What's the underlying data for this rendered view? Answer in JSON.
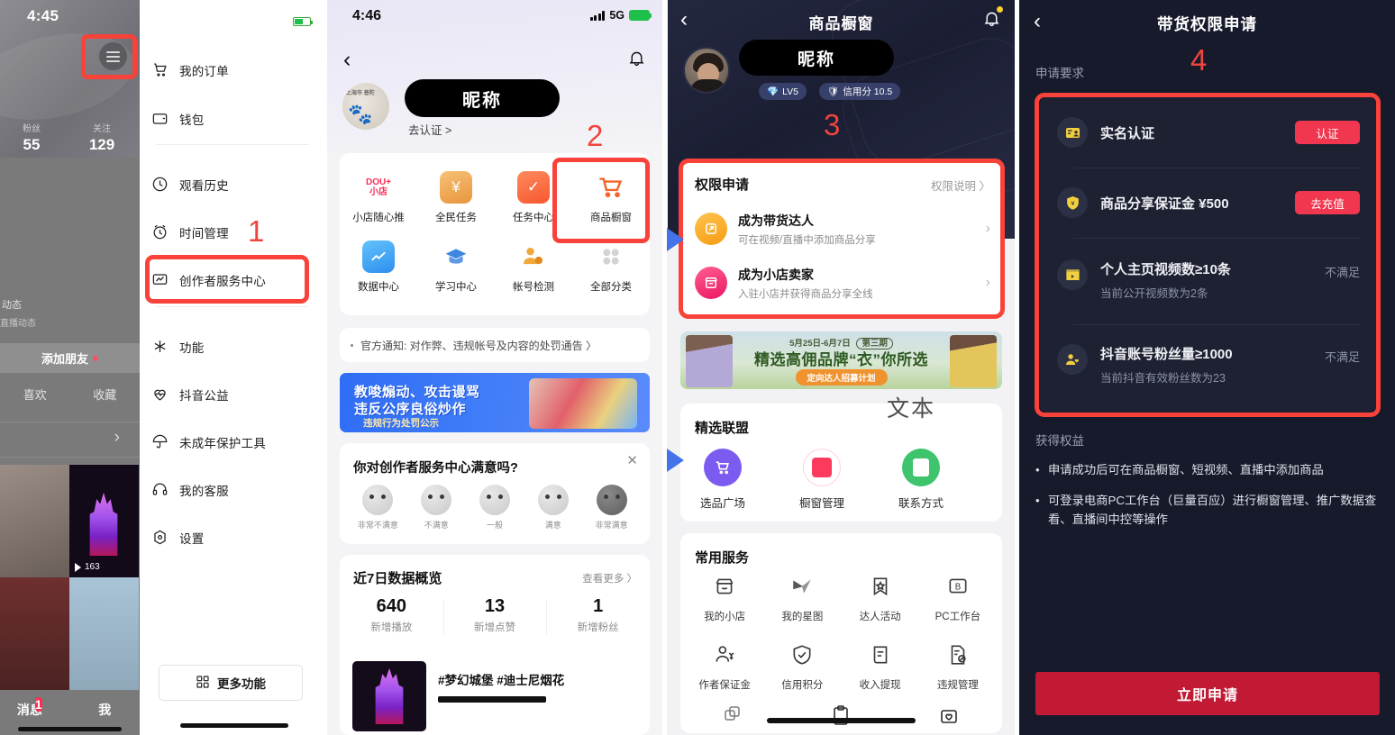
{
  "panel1": {
    "status": {
      "time": "4:45"
    },
    "profile": {
      "stats": [
        {
          "label": "粉丝",
          "value": "55"
        },
        {
          "label": "关注",
          "value": "129"
        }
      ],
      "dynamic_label": "动态",
      "dynamic_sub": "直播动态",
      "add_friend": "添加朋友",
      "tabs": [
        "喜欢",
        "收藏"
      ],
      "video_play_count": "163"
    },
    "bottom_nav": [
      {
        "label": "消息",
        "badge": "1"
      },
      {
        "label": "我",
        "badge": ""
      }
    ],
    "drawer": {
      "items": [
        {
          "label": "我的订单",
          "icon": "cart-icon"
        },
        {
          "label": "钱包",
          "icon": "wallet-icon"
        },
        {
          "label": "观看历史",
          "icon": "clock-icon"
        },
        {
          "label": "时间管理",
          "icon": "alarm-icon"
        },
        {
          "label": "创作者服务中心",
          "icon": "monitor-icon"
        },
        {
          "label": "功能",
          "icon": "sparkle-icon"
        },
        {
          "label": "抖音公益",
          "icon": "heart-icon"
        },
        {
          "label": "未成年保护工具",
          "icon": "umbrella-icon"
        },
        {
          "label": "我的客服",
          "icon": "headset-icon"
        },
        {
          "label": "设置",
          "icon": "gear-icon"
        }
      ],
      "more_button": "更多功能",
      "more_icon": "grid-icon"
    },
    "annotation": "1"
  },
  "panel2": {
    "status": {
      "time": "4:46",
      "network": "5G"
    },
    "header": {
      "back_icon": "chevron-left-icon",
      "bell_icon": "bell-icon"
    },
    "profile": {
      "nickname": "昵称",
      "verify_link": "去认证 >",
      "avatar_badge": "上海市 普陀"
    },
    "grid": [
      {
        "label": "小店随心推",
        "icon": "doudian-icon",
        "color": "#fe2c55"
      },
      {
        "label": "全民任务",
        "icon": "coin-stack-icon",
        "color": "#f0a445"
      },
      {
        "label": "任务中心",
        "icon": "checklist-icon",
        "color": "#fa6a42"
      },
      {
        "label": "商品橱窗",
        "icon": "shopping-cart-icon",
        "color": "#f4662a"
      },
      {
        "label": "数据中心",
        "icon": "chart-icon",
        "color": "#3fa9f5"
      },
      {
        "label": "学习中心",
        "icon": "graduation-cap-icon",
        "color": "#3f86e0"
      },
      {
        "label": "帐号检测",
        "icon": "account-search-icon",
        "color": "#f0a83a"
      },
      {
        "label": "全部分类",
        "icon": "four-dots-icon",
        "color": "#d6d6d6"
      }
    ],
    "notice": "官方通知: 对作弊、违规帐号及内容的处罚通告 〉",
    "banner": {
      "line1": "教唆煽动、攻击谩骂",
      "line2": "违反公序良俗炒作",
      "line3": "违规行为处罚公示"
    },
    "survey": {
      "question": "你对创作者服务中心满意吗?",
      "close_icon": "close-icon",
      "options": [
        "非常不满意",
        "不满意",
        "一般",
        "满意",
        "非常满意"
      ]
    },
    "data_overview": {
      "title": "近7日数据概览",
      "more": "查看更多 〉",
      "stats": [
        {
          "value": "640",
          "label": "新增播放"
        },
        {
          "value": "13",
          "label": "新增点赞"
        },
        {
          "value": "1",
          "label": "新增粉丝"
        }
      ],
      "video_title": "#梦幻城堡 #迪士尼烟花"
    },
    "annotation": "2"
  },
  "panel3": {
    "header": {
      "back_icon": "chevron-left-icon",
      "title": "商品橱窗",
      "bell_icon": "bell-icon"
    },
    "profile": {
      "nickname": "昵称",
      "level_badge": "LV5",
      "level_icon": "diamond-icon",
      "credit_badge": "信用分 10.5",
      "credit_icon": "shield-icon"
    },
    "permission": {
      "title": "权限申请",
      "link": "权限说明 〉",
      "rows": [
        {
          "title": "成为带货达人",
          "sub": "可在视频/直播中添加商品分享",
          "icon": "bag-share-icon",
          "color": "#f5a623"
        },
        {
          "title": "成为小店卖家",
          "sub": "入驻小店并获得商品分享全线",
          "icon": "store-icon",
          "color": "#ef2e6b"
        }
      ]
    },
    "banner": {
      "date": "5月25日-6月7日",
      "phase": "第三期",
      "title": "精选高佣品牌“衣”你所选",
      "pill": "定向达人招募计划"
    },
    "union": {
      "title": "精选联盟",
      "items": [
        {
          "label": "选品广场",
          "icon": "cart-icon",
          "color": "#7c5cf0"
        },
        {
          "label": "橱窗管理",
          "icon": "shop-bag-icon",
          "color": "#fb3a5d"
        },
        {
          "label": "联系方式",
          "icon": "contact-card-icon",
          "color": "#3ec46d"
        }
      ]
    },
    "services": {
      "title": "常用服务",
      "items": [
        {
          "label": "我的小店",
          "icon": "store-outline-icon"
        },
        {
          "label": "我的星图",
          "icon": "starmap-icon"
        },
        {
          "label": "达人活动",
          "icon": "star-bookmark-icon"
        },
        {
          "label": "PC工作台",
          "icon": "monitor-b-icon"
        },
        {
          "label": "作者保证金",
          "icon": "person-yuan-icon"
        },
        {
          "label": "信用积分",
          "icon": "shield-check-icon"
        },
        {
          "label": "收入提现",
          "icon": "receipt-icon"
        },
        {
          "label": "违规管理",
          "icon": "doc-ban-icon"
        }
      ]
    },
    "annotation": "3",
    "text_annotation": "文本"
  },
  "panel4": {
    "header": {
      "back_icon": "chevron-left-icon",
      "title": "带货权限申请"
    },
    "section_requirements": "申请要求",
    "requirements": [
      {
        "title": "实名认证",
        "sub": "",
        "icon": "id-card-icon",
        "icon_color": "#f2cf3d",
        "action": "认证",
        "action_type": "button"
      },
      {
        "title": "商品分享保证金 ¥500",
        "sub": "",
        "icon": "shield-yuan-icon",
        "icon_color": "#f2cf3d",
        "action": "去充值",
        "action_type": "button"
      },
      {
        "title": "个人主页视频数≥10条",
        "sub": "当前公开视频数为2条",
        "icon": "clapper-icon",
        "icon_color": "#f2cf3d",
        "action": "不满足",
        "action_type": "state"
      },
      {
        "title": "抖音账号粉丝量≥1000",
        "sub": "当前抖音有效粉丝数为23",
        "icon": "fans-icon",
        "icon_color": "#f2cf3d",
        "action": "不满足",
        "action_type": "state"
      }
    ],
    "section_benefits": "获得权益",
    "benefits": [
      "申请成功后可在商品橱窗、短视频、直播中添加商品",
      "可登录电商PC工作台（巨量百应）进行橱窗管理、推广数据查看、直播间中控等操作"
    ],
    "apply_button": "立即申请",
    "annotation": "4"
  },
  "colors": {
    "annotation_red": "#f9423a",
    "brand_red": "#fe2c55",
    "apply_red": "#c21a35",
    "blue_arrow": "#4472e8"
  }
}
